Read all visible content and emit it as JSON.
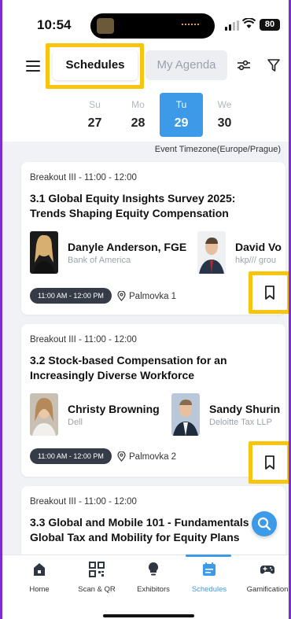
{
  "status_bar": {
    "time": "10:54",
    "battery": "80"
  },
  "header": {
    "tabs": [
      {
        "label": "Schedules",
        "active": true
      },
      {
        "label": "My Agenda",
        "active": false
      }
    ],
    "days": [
      {
        "name": "Su",
        "date": "27",
        "active": false
      },
      {
        "name": "Mo",
        "date": "28",
        "active": false
      },
      {
        "name": "Tu",
        "date": "29",
        "active": true
      },
      {
        "name": "We",
        "date": "30",
        "active": false
      }
    ]
  },
  "timezone": "Event Timezone(Europe/Prague)",
  "sessions": [
    {
      "slot": "Breakout III - 11:00 - 12:00",
      "title": "3.1 Global Equity Insights Survey 2025: Trends Shaping Equity Compensation",
      "speakers": [
        {
          "name": "Danyle Anderson, FGE",
          "org": "Bank of America"
        },
        {
          "name": "David Vo",
          "org": "hkp/// grou"
        }
      ],
      "time": "11:00 AM - 12:00 PM",
      "location": "Palmovka 1"
    },
    {
      "slot": "Breakout III - 11:00 - 12:00",
      "title": "3.2 Stock-based Compensation for an Increasingly Diverse Workforce",
      "speakers": [
        {
          "name": "Christy Browning",
          "org": "Dell"
        },
        {
          "name": "Sandy Shurin",
          "org": "Deloitte Tax LLP"
        }
      ],
      "time": "11:00 AM - 12:00 PM",
      "location": "Palmovka 2"
    },
    {
      "slot": "Breakout III - 11:00 - 12:00",
      "title": "3.3 Global and Mobile 101 - Fundamentals of Global Tax and Mobility for Equity Plans"
    }
  ],
  "bottom_nav": [
    {
      "label": "Home",
      "icon": "home-icon"
    },
    {
      "label": "Scan & QR",
      "icon": "qr-icon"
    },
    {
      "label": "Exhibitors",
      "icon": "lightbulb-icon"
    },
    {
      "label": "Schedules",
      "icon": "calendar-icon",
      "active": true
    },
    {
      "label": "Gamification",
      "icon": "gamepad-icon"
    }
  ],
  "colors": {
    "accent": "#3d9ae8",
    "highlight": "#f7c510",
    "pill": "#353b47"
  }
}
